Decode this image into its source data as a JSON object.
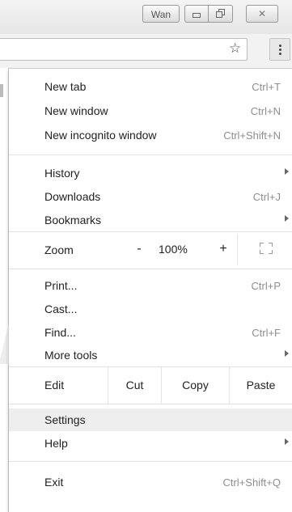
{
  "window": {
    "profile_label": "Wan",
    "close_glyph": "✕"
  },
  "toolbar": {
    "bookmark_icon": "star-icon",
    "menu_icon": "three-dots-vertical-icon"
  },
  "menu": {
    "new_tab": {
      "label": "New tab",
      "shortcut": "Ctrl+T"
    },
    "new_window": {
      "label": "New window",
      "shortcut": "Ctrl+N"
    },
    "new_incognito": {
      "label": "New incognito window",
      "shortcut": "Ctrl+Shift+N"
    },
    "history": {
      "label": "History"
    },
    "downloads": {
      "label": "Downloads",
      "shortcut": "Ctrl+J"
    },
    "bookmarks": {
      "label": "Bookmarks"
    },
    "zoom": {
      "label": "Zoom",
      "minus": "-",
      "value": "100%",
      "plus": "+"
    },
    "print": {
      "label": "Print...",
      "shortcut": "Ctrl+P"
    },
    "cast": {
      "label": "Cast..."
    },
    "find": {
      "label": "Find...",
      "shortcut": "Ctrl+F"
    },
    "more_tools": {
      "label": "More tools"
    },
    "edit": {
      "label": "Edit",
      "cut": "Cut",
      "copy": "Copy",
      "paste": "Paste"
    },
    "settings": {
      "label": "Settings"
    },
    "help": {
      "label": "Help"
    },
    "exit": {
      "label": "Exit",
      "shortcut": "Ctrl+Shift+Q"
    }
  },
  "colors": {
    "menu_background": "#ffffff",
    "highlight": "#eeeeee",
    "shortcut_text": "#8e8e8e",
    "separator": "#e3e3e3"
  }
}
